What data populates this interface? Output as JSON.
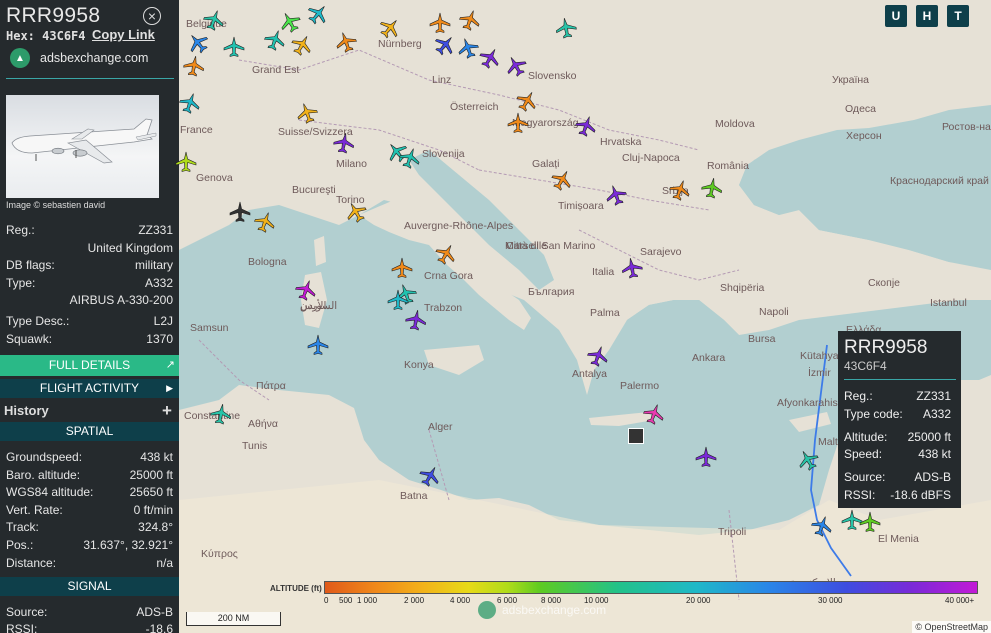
{
  "sidebar": {
    "callsign": "RRR9958",
    "hex_label": "Hex:",
    "hex": "43C6F4",
    "copy_link": "Copy Link",
    "brand": "adsbexchange.com",
    "photo_credit": "Image © sebastien david",
    "rows": [
      {
        "k": "Reg.:",
        "v": "ZZ331"
      },
      {
        "k": "",
        "v": "United Kingdom"
      },
      {
        "k": "DB flags:",
        "v": "military"
      },
      {
        "k": "Type:",
        "v": "A332"
      },
      {
        "k": "",
        "v": "AIRBUS A-330-200"
      },
      {
        "k": "Type Desc.:",
        "v": "L2J"
      },
      {
        "k": "Squawk:",
        "v": "1370"
      }
    ],
    "full_details": "FULL DETAILS",
    "flight_activity": "FLIGHT ACTIVITY",
    "history": "History",
    "spatial_header": "SPATIAL",
    "spatial": [
      {
        "k": "Groundspeed:",
        "v": "438 kt"
      },
      {
        "k": "Baro. altitude:",
        "v": "25000 ft"
      },
      {
        "k": "WGS84 altitude:",
        "v": "25650 ft"
      },
      {
        "k": "Vert. Rate:",
        "v": "0 ft/min"
      },
      {
        "k": "Track:",
        "v": "324.8°"
      },
      {
        "k": "Pos.:",
        "v": "31.637°, 32.921°"
      },
      {
        "k": "Distance:",
        "v": "n/a"
      }
    ],
    "signal_header": "SIGNAL",
    "signal": [
      {
        "k": "Source:",
        "v": "ADS-B"
      },
      {
        "k": "RSSI:",
        "v": "-18.6"
      }
    ]
  },
  "map": {
    "controls": [
      "U",
      "H",
      "T"
    ],
    "labels": [
      "Belgique",
      "Nürnberg",
      "Linz",
      "Slovensko",
      "Österreich",
      "Magyarország",
      "Moldova",
      "Україна",
      "Одеса",
      "Херсон",
      "Ростов-на-Дону",
      "Краснодарский край",
      "Grand Est",
      "France",
      "Suisse/Svizzera",
      "Milano",
      "Slovenija",
      "Hrvatska",
      "Cluj-Napoca",
      "România",
      "Galați",
      "Timișoara",
      "Srbija",
      "Bucureşti",
      "Torino",
      "Genova",
      "Bologna",
      "Auvergne-Rhône-Alpes",
      "Marseille",
      "Città di San Marino",
      "Sarajevo",
      "Crna Gora",
      "България",
      "Italia",
      "Shqipëria",
      "Скопје",
      "Istanbul",
      "Samsun",
      "Trabzon",
      "Palma",
      "Napoli",
      "Ελλάδα",
      "Bursa",
      "Ankara",
      "Kütahya",
      "İzmir",
      "Afyonkarahisar",
      "Konya",
      "Antalya",
      "Palermo",
      "Πάτρα",
      "Αθήνα",
      "Constantine",
      "Tunis",
      "Alger",
      "Batna",
      "Malta",
      "Tripoli",
      "Κύπρος",
      "الإسكندرية",
      "El Menia",
      "السويس",
      "الأردن"
    ],
    "tooltip": {
      "callsign": "RRR9958",
      "hex": "43C6F4",
      "rows1": [
        {
          "k": "Reg.:",
          "v": "ZZ331"
        },
        {
          "k": "Type code:",
          "v": "A332"
        }
      ],
      "rows2": [
        {
          "k": "Altitude:",
          "v": "25000 ft"
        },
        {
          "k": "Speed:",
          "v": "438 kt"
        }
      ],
      "rows3": [
        {
          "k": "Source:",
          "v": "ADS-B"
        },
        {
          "k": "RSSI:",
          "v": "-18.6 dBFS"
        }
      ]
    },
    "altitude_legend": {
      "label": "ALTITUDE (ft)",
      "ticks": [
        "0",
        "500",
        "1 000",
        "2 000",
        "4 000",
        "6 000",
        "8 000",
        "10 000",
        "20 000",
        "30 000",
        "40 000+"
      ]
    },
    "watermark": "adsbexchange.com",
    "scale": "200 NM",
    "attribution": "© OpenStreetMap"
  }
}
